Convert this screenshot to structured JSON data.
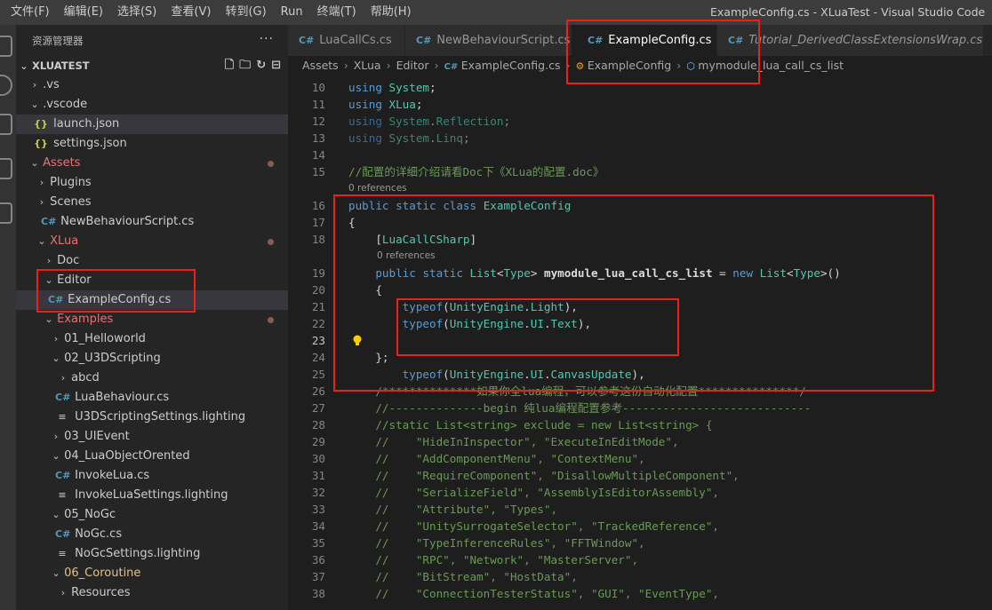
{
  "menu": [
    "文件(F)",
    "编辑(E)",
    "选择(S)",
    "查看(V)",
    "转到(G)",
    "Run",
    "终端(T)",
    "帮助(H)"
  ],
  "window_title": "ExampleConfig.cs - XLuaTest - Visual Studio Code",
  "sidebar": {
    "title": "资源管理器",
    "more": "···",
    "root": "XLUATEST",
    "items": [
      {
        "label": ".vs",
        "kind": "folder",
        "expanded": false
      },
      {
        "label": ".vscode",
        "kind": "folder",
        "expanded": true
      },
      {
        "label": "launch.json",
        "kind": "json"
      },
      {
        "label": "settings.json",
        "kind": "json"
      },
      {
        "label": "Assets",
        "kind": "folder",
        "expanded": true
      },
      {
        "label": "Plugins",
        "kind": "folder",
        "expanded": false
      },
      {
        "label": "Scenes",
        "kind": "folder",
        "expanded": false
      },
      {
        "label": "NewBehaviourScript.cs",
        "kind": "cs"
      },
      {
        "label": "XLua",
        "kind": "folder",
        "expanded": true
      },
      {
        "label": "Doc",
        "kind": "folder",
        "expanded": false
      },
      {
        "label": "Editor",
        "kind": "folder",
        "expanded": true
      },
      {
        "label": "ExampleConfig.cs",
        "kind": "cs"
      },
      {
        "label": "Examples",
        "kind": "folder",
        "expanded": true
      },
      {
        "label": "01_Helloworld",
        "kind": "folder",
        "expanded": false
      },
      {
        "label": "02_U3DScripting",
        "kind": "folder",
        "expanded": true
      },
      {
        "label": "abcd",
        "kind": "folder",
        "expanded": false
      },
      {
        "label": "LuaBehaviour.cs",
        "kind": "cs"
      },
      {
        "label": "U3DScriptingSettings.lighting",
        "kind": "lighting"
      },
      {
        "label": "03_UIEvent",
        "kind": "folder",
        "expanded": false
      },
      {
        "label": "04_LuaObjectOrented",
        "kind": "folder",
        "expanded": true
      },
      {
        "label": "InvokeLua.cs",
        "kind": "cs"
      },
      {
        "label": "InvokeLuaSettings.lighting",
        "kind": "lighting"
      },
      {
        "label": "05_NoGc",
        "kind": "folder",
        "expanded": true
      },
      {
        "label": "NoGc.cs",
        "kind": "cs"
      },
      {
        "label": "NoGcSettings.lighting",
        "kind": "lighting"
      },
      {
        "label": "06_Coroutine",
        "kind": "folder",
        "expanded": true
      },
      {
        "label": "Resources",
        "kind": "folder",
        "expanded": false
      }
    ]
  },
  "tabs": [
    {
      "label": "LuaCallCs.cs"
    },
    {
      "label": "NewBehaviourScript.cs"
    },
    {
      "label": "ExampleConfig.cs",
      "close": "×"
    },
    {
      "label": "Tutorial_DerivedClassExtensionsWrap.cs"
    }
  ],
  "breadcrumb": [
    "Assets",
    "XLua",
    "Editor",
    "ExampleConfig.cs",
    "ExampleConfig",
    "mymodule_lua_call_cs_list"
  ],
  "codelens": {
    "refs1": "0 references",
    "refs2": "0 references"
  },
  "lines": [
    {
      "n": "10",
      "t": "using System;"
    },
    {
      "n": "11",
      "t": "using XLua;"
    },
    {
      "n": "12",
      "t": "using System.Reflection;"
    },
    {
      "n": "13",
      "t": "using System.Linq;"
    },
    {
      "n": "14",
      "t": ""
    },
    {
      "n": "15",
      "t": "//配置的详细介绍请看Doc下《XLua的配置.doc》"
    },
    {
      "n": "16",
      "t": "public static class ExampleConfig"
    },
    {
      "n": "17",
      "t": "{"
    },
    {
      "n": "18",
      "t": "    [LuaCallCSharp]"
    },
    {
      "n": "19",
      "t": "    public static List<Type> mymodule_lua_call_cs_list = new List<Type>()"
    },
    {
      "n": "20",
      "t": "    {"
    },
    {
      "n": "21",
      "t": "        typeof(UnityEngine.Light),"
    },
    {
      "n": "22",
      "t": "        typeof(UnityEngine.UI.Text),"
    },
    {
      "n": "23",
      "t": "        typeof(UnityEngine.UI.CanvasUpdate),"
    },
    {
      "n": "24",
      "t": "    };"
    },
    {
      "n": "25",
      "t": ""
    },
    {
      "n": "26",
      "t": "    /**************如果你全lua编程，可以参考这份自动化配置***************/"
    },
    {
      "n": "27",
      "t": "    //--------------begin 纯lua编程配置参考----------------------------"
    },
    {
      "n": "28",
      "t": "    //static List<string> exclude = new List<string> {"
    },
    {
      "n": "29",
      "t": "    //    \"HideInInspector\", \"ExecuteInEditMode\","
    },
    {
      "n": "30",
      "t": "    //    \"AddComponentMenu\", \"ContextMenu\","
    },
    {
      "n": "31",
      "t": "    //    \"RequireComponent\", \"DisallowMultipleComponent\","
    },
    {
      "n": "32",
      "t": "    //    \"SerializeField\", \"AssemblyIsEditorAssembly\","
    },
    {
      "n": "33",
      "t": "    //    \"Attribute\", \"Types\","
    },
    {
      "n": "34",
      "t": "    //    \"UnitySurrogateSelector\", \"TrackedReference\","
    },
    {
      "n": "35",
      "t": "    //    \"TypeInferenceRules\", \"FFTWindow\","
    },
    {
      "n": "36",
      "t": "    //    \"RPC\", \"Network\", \"MasterServer\","
    },
    {
      "n": "37",
      "t": "    //    \"BitStream\", \"HostData\","
    },
    {
      "n": "38",
      "t": "    //    \"ConnectionTesterStatus\", \"GUI\", \"EventType\","
    }
  ],
  "colors": {
    "annotation": "#e8211b",
    "editor_bg": "#1e1e1e",
    "sidebar_bg": "#252526"
  }
}
